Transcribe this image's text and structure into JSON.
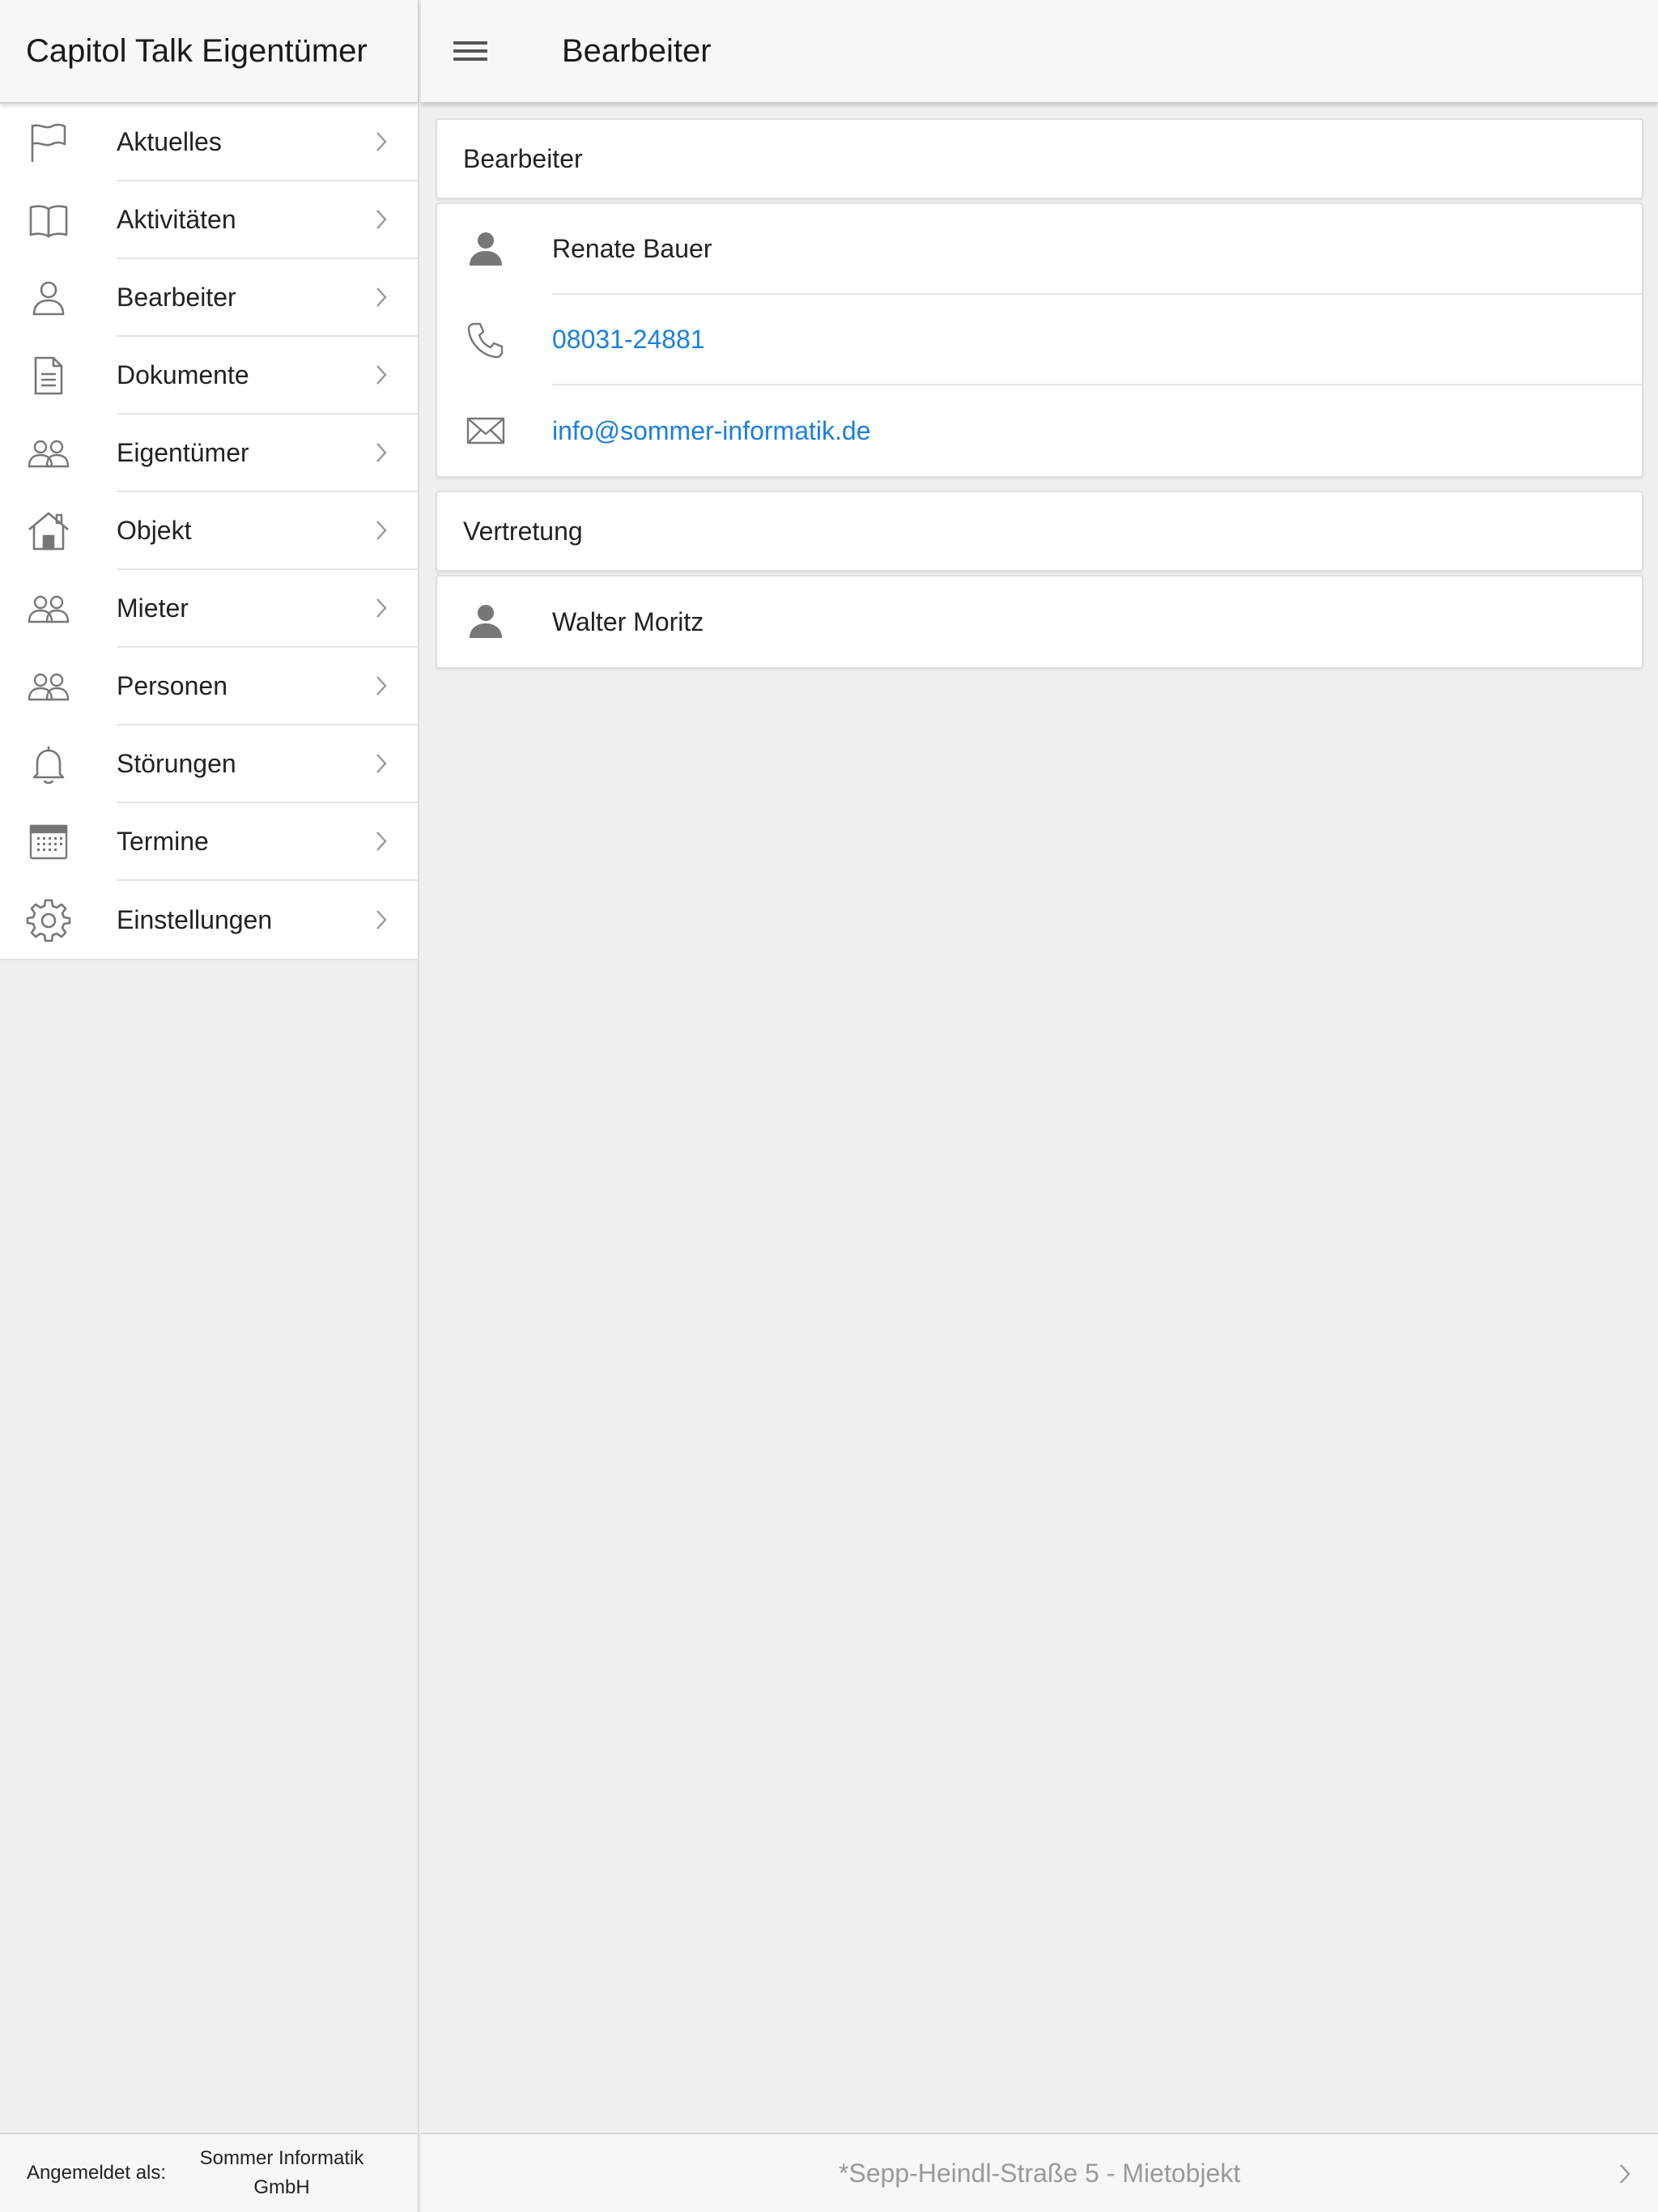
{
  "app": {
    "title": "Capitol Talk Eigentümer"
  },
  "sidebar": {
    "items": [
      {
        "label": "Aktuelles",
        "icon": "flag-icon"
      },
      {
        "label": "Aktivitäten",
        "icon": "book-icon"
      },
      {
        "label": "Bearbeiter",
        "icon": "person-icon"
      },
      {
        "label": "Dokumente",
        "icon": "document-icon"
      },
      {
        "label": "Eigentümer",
        "icon": "people-icon"
      },
      {
        "label": "Objekt",
        "icon": "house-icon"
      },
      {
        "label": "Mieter",
        "icon": "people-icon"
      },
      {
        "label": "Personen",
        "icon": "people-icon"
      },
      {
        "label": "Störungen",
        "icon": "bell-icon"
      },
      {
        "label": "Termine",
        "icon": "calendar-icon"
      },
      {
        "label": "Einstellungen",
        "icon": "gear-icon"
      }
    ],
    "footer": {
      "label": "Angemeldet als:",
      "value": "Sommer Informatik GmbH"
    }
  },
  "header": {
    "title": "Bearbeiter",
    "menu_icon": "hamburger-menu-icon"
  },
  "main": {
    "bearbeiter": {
      "heading": "Bearbeiter",
      "name": "Renate Bauer",
      "phone": "08031-24881",
      "email": "info@sommer-informatik.de"
    },
    "vertretung": {
      "heading": "Vertretung",
      "name": "Walter Moritz"
    }
  },
  "footer": {
    "location": "*Sepp-Heindl-Straße 5 - Mietobjekt"
  },
  "colors": {
    "link": "#1a7fe0",
    "icon": "#777777",
    "background": "#efefef"
  }
}
